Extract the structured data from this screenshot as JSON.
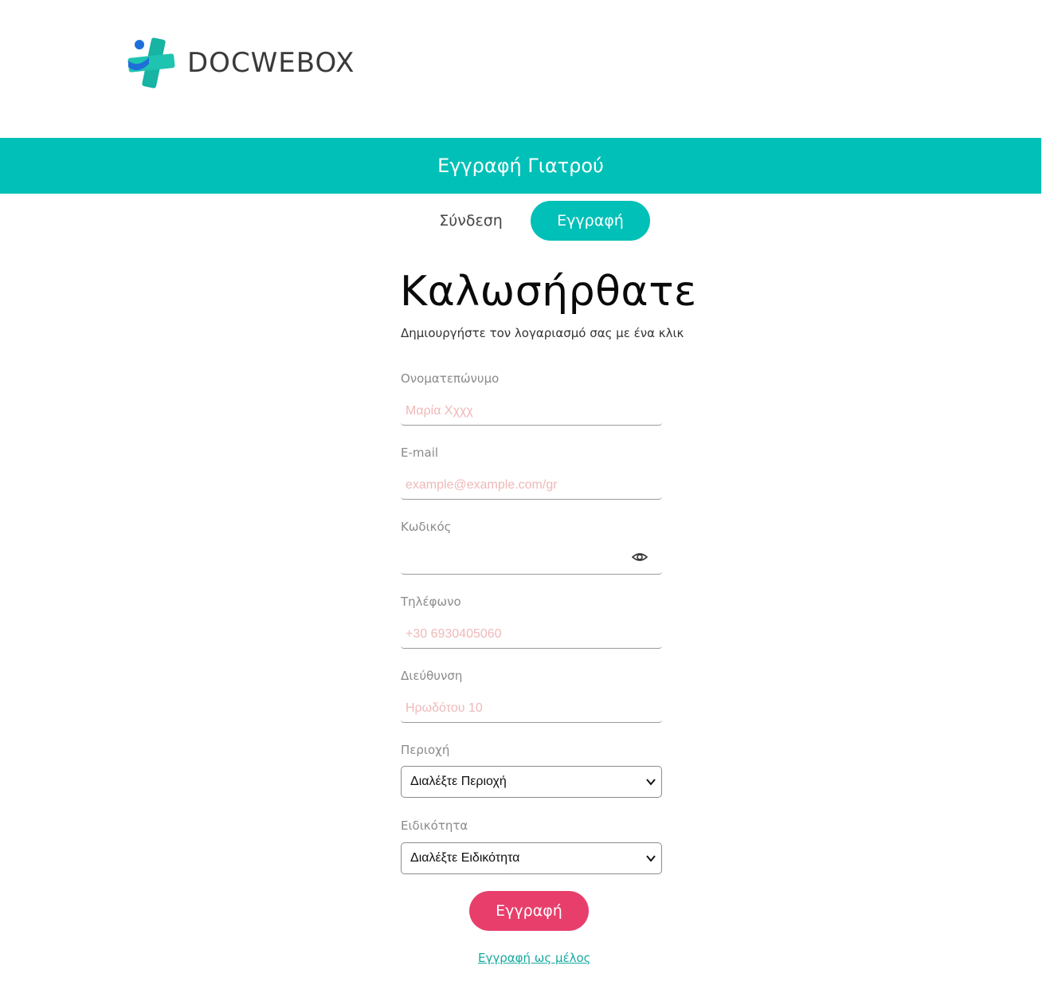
{
  "brand": {
    "name": "DOCWEBOX",
    "icon": "medical-cross-logo-icon",
    "colors": {
      "teal": "#00c0b7",
      "blue": "#1e6fd9",
      "pink": "#e83e6c"
    }
  },
  "banner": {
    "title": "Εγγραφή Γιατρού"
  },
  "tabs": {
    "login": "Σύνδεση",
    "register": "Εγγραφή",
    "active": "register"
  },
  "form": {
    "heading": "Καλωσήρθατε",
    "subtitle": "Δημιουργήστε τον λογαριασμό σας με ένα κλικ",
    "fields": {
      "fullname": {
        "label": "Ονοματεπώνυμο",
        "placeholder": "Μαρία Χχχχ",
        "value": ""
      },
      "email": {
        "label": "E-mail",
        "placeholder": "example@example.com/gr",
        "value": ""
      },
      "password": {
        "label": "Κωδικός",
        "placeholder": "",
        "value": "",
        "icon": "eye-icon"
      },
      "phone": {
        "label": "Τηλέφωνο",
        "placeholder": "+30 6930405060",
        "value": ""
      },
      "address": {
        "label": "Διεύθυνση",
        "placeholder": "Ηρωδότου 10",
        "value": ""
      },
      "region": {
        "label": "Περιοχή",
        "selected": "Διαλέξτε Περιοχή"
      },
      "specialty": {
        "label": "Ειδικότητα",
        "selected": "Διαλέξτε Ειδικότητα"
      }
    },
    "submit_label": "Εγγραφή",
    "member_link": "Εγγραφή ως μέλος"
  }
}
